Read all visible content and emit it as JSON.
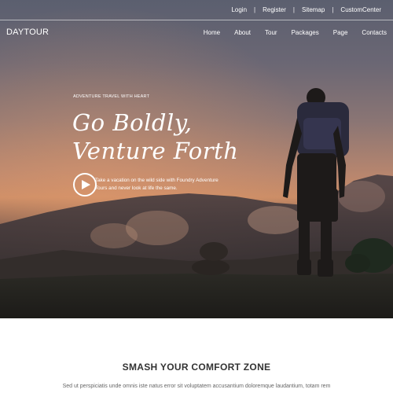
{
  "top_links": [
    "Login",
    "Register",
    "Sitemap",
    "CustomCenter"
  ],
  "brand": "DAYTOUR",
  "nav": [
    "Home",
    "About",
    "Tour",
    "Packages",
    "Page",
    "Contacts"
  ],
  "hero": {
    "tagline": "ADVENTURE TRAVEL WITH HEART",
    "headline_line1": "Go Boldly,",
    "headline_line2": "Venture Forth",
    "description": "Take a vacation on the wild side with Foundry Adventure Tours and never look at life the same."
  },
  "section": {
    "title": "SMASH YOUR COMFORT ZONE",
    "text": "Sed ut perspiciatis unde omnis iste natus error sit voluptatem accusantium doloremque laudantium, totam rem"
  },
  "icons": {
    "play": "play-icon"
  },
  "colors": {
    "text_dark": "#333333",
    "text_muted": "#666666",
    "white": "#ffffff"
  }
}
